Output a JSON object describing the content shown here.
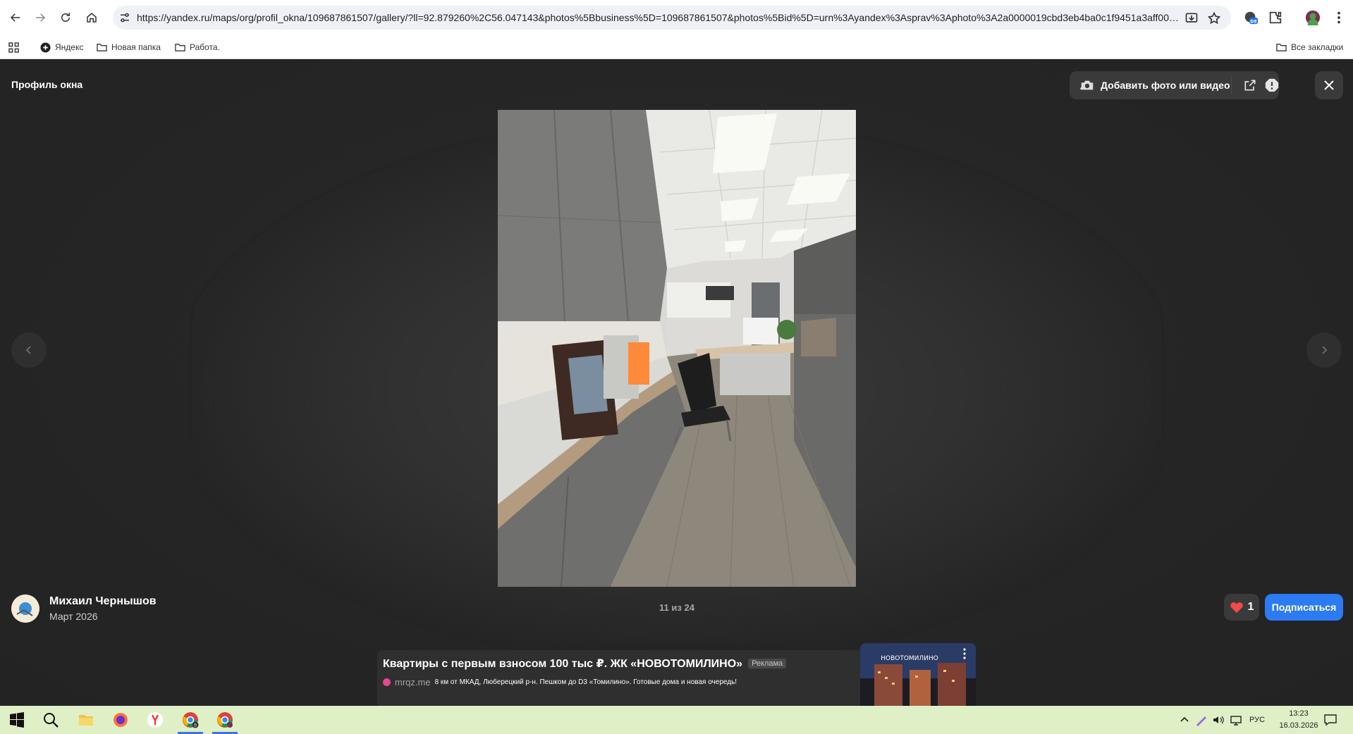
{
  "browser": {
    "url": "https://yandex.ru/maps/org/profil_okna/109687861507/gallery/?ll=92.879260%2C56.047143&photos%5Bbusiness%5D=109687861507&photos%5Bid%5D=urn%3Ayandex%3Asprav%3Aphoto%3A2a0000019cbd3eb4ba0c1f9451a3aff004c...",
    "profile_badge": "DE",
    "bookmarks": [
      {
        "label": "Яндекс",
        "icon": "yandex-plus-icon"
      },
      {
        "label": "Новая папка",
        "icon": "folder-icon"
      },
      {
        "label": "Работа.",
        "icon": "folder-icon"
      }
    ],
    "all_bookmarks_label": "Все закладки"
  },
  "viewer": {
    "title": "Профиль окна",
    "add_media_label": "Добавить фото или видео",
    "counter": "11 из 24",
    "author": {
      "name": "Михаил Чернышов",
      "date": "Март 2026"
    },
    "likes": "1",
    "subscribe_label": "Подписаться"
  },
  "ad": {
    "title": "Квартиры с первым взносом 100 тыс ₽. ЖК «НОВОТОМИЛИНО»",
    "tag": "Реклама",
    "domain": "mrqz.me",
    "text": "8 км от МКАД, Люберецкий р-н. Пешком до D3 «Томилино». Готовые дома и новая очередь!",
    "image_caption": "НОВОТОМИЛИНО"
  },
  "taskbar": {
    "language": "РУС",
    "time": "13:23",
    "date": "16.03.2026",
    "chrome_badge": "0"
  },
  "colors": {
    "accent_blue": "#2c7bf2",
    "heart_red": "#f04a4a",
    "viewer_bg": "#262626",
    "taskbar_bg": "#dff0c6"
  }
}
